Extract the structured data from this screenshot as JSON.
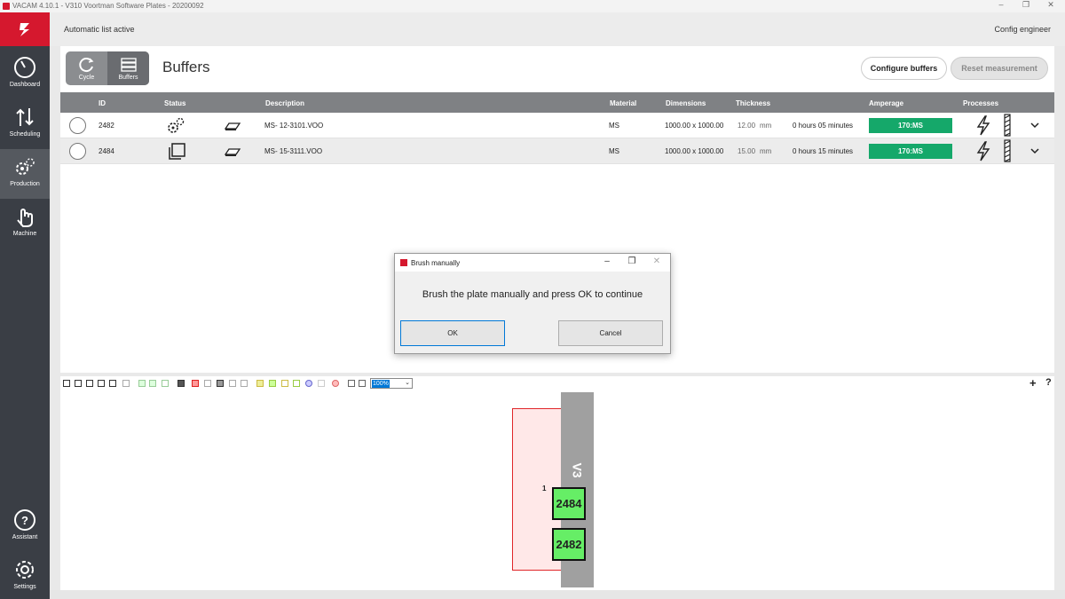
{
  "window": {
    "title": "VACAM 4.10.1 - V310   Voortman Software Plates - 20200092",
    "controls": [
      "–",
      "❐",
      "✕"
    ]
  },
  "sidebar": {
    "brand_icon": "voortman-logo-icon",
    "items": [
      {
        "label": "Dashboard",
        "icon": "gauge-icon"
      },
      {
        "label": "Scheduling",
        "icon": "sort-arrows-icon"
      },
      {
        "label": "Production",
        "icon": "gears-icon"
      },
      {
        "label": "Machine",
        "icon": "hand-pointer-icon"
      }
    ],
    "bottom_items": [
      {
        "label": "Assistant",
        "icon": "help-icon"
      },
      {
        "label": "Settings",
        "icon": "gear-icon"
      }
    ],
    "active": "Production"
  },
  "topstrip": {
    "status": "Automatic list active",
    "user": "Config engineer"
  },
  "main": {
    "view_toggle": [
      {
        "label": "Cycle",
        "icon": "cycle-icon"
      },
      {
        "label": "Buffers",
        "icon": "buffers-icon"
      }
    ],
    "selected_view": "Buffers",
    "title": "Buffers",
    "buttons": {
      "configure": "Configure buffers",
      "reset": "Reset measurement"
    },
    "table": {
      "headers": {
        "id": "ID",
        "status": "Status",
        "description": "Description",
        "material": "Material",
        "dimensions": "Dimensions",
        "thickness": "Thickness",
        "amperage": "Amperage",
        "processes": "Processes"
      },
      "rows": [
        {
          "id": "2482",
          "status_icon": "gears-icon",
          "description": "MS- 12-3101.VOO",
          "material": "MS",
          "dimensions": "1000.00 x 1000.00",
          "thickness": "12.00",
          "unit": "mm",
          "time": "0 hours 05 minutes",
          "amperage": "170:MS"
        },
        {
          "id": "2484",
          "status_icon": "copy-icon",
          "description": "MS- 15-3111.VOO",
          "material": "MS",
          "dimensions": "1000.00 x 1000.00",
          "thickness": "15.00",
          "unit": "mm",
          "time": "0 hours 15 minutes",
          "amperage": "170:MS"
        }
      ]
    }
  },
  "dialog": {
    "title": "Brush manually",
    "message": "Brush the plate manually and press OK to continue",
    "ok": "OK",
    "cancel": "Cancel"
  },
  "lower": {
    "zoom": "100%",
    "plus": "+",
    "help": "?",
    "position_number": "1",
    "conveyor_label": "V3",
    "tags": [
      "2484",
      "2482"
    ]
  },
  "colors": {
    "brand_red": "#d5182e",
    "sidebar": "#3a3e45",
    "amperage_green": "#15a86a",
    "tag_green": "#66ee66",
    "plate_outline": "#e0262a"
  }
}
